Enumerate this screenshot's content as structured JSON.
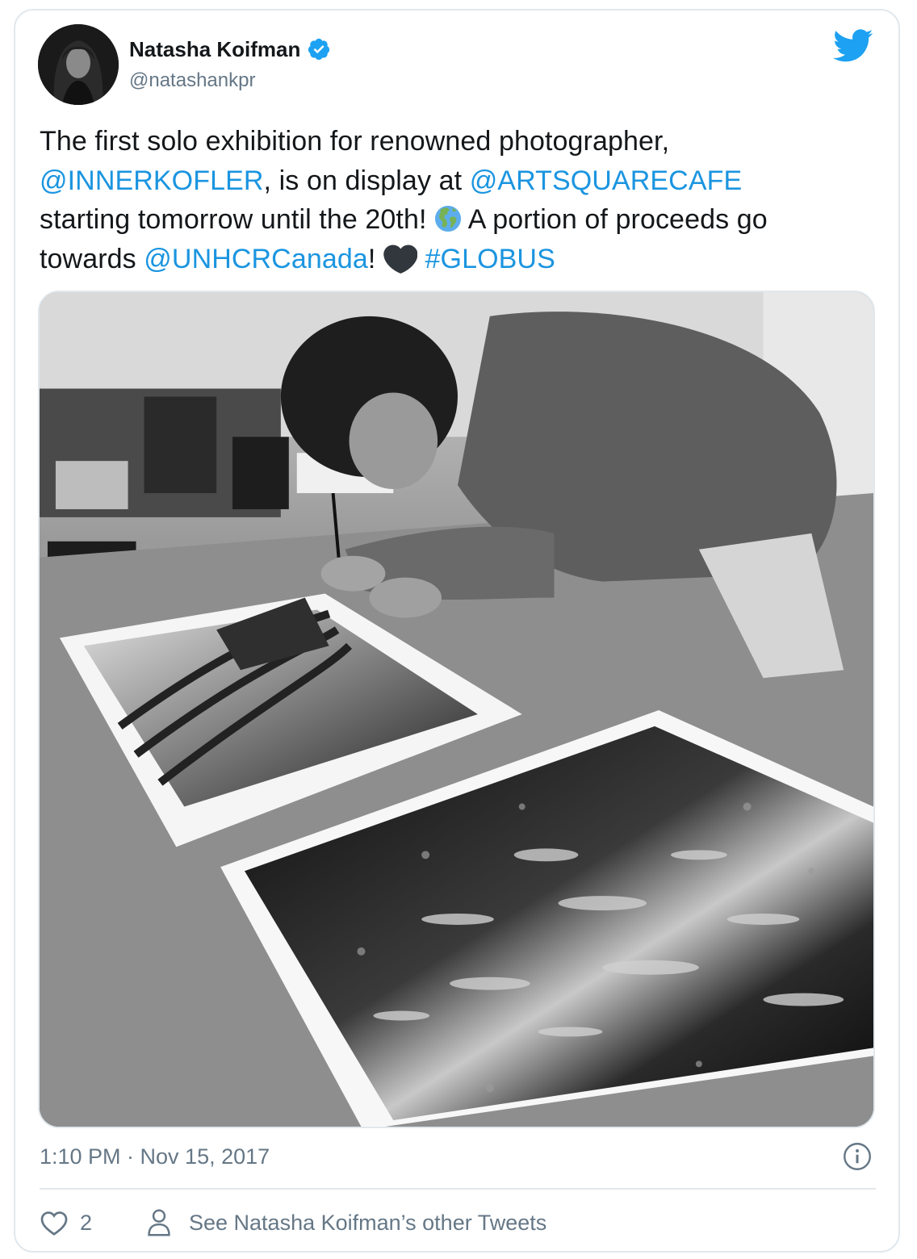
{
  "author": {
    "name": "Natasha Koifman",
    "handle": "@natashankpr",
    "verified": true
  },
  "tweet": {
    "line1": "The first solo exhibition for renowned photographer,",
    "mention1": "@INNERKOFLER",
    "text2": ", is on display at ",
    "mention2": "@ARTSQUARECAFE",
    "text3": "starting tomorrow until the 20th!",
    "text4": "  A portion of proceeds go towards ",
    "mention3": "@UNHCRCanada",
    "text5": "!",
    "hashtag": "#GLOBUS"
  },
  "meta": {
    "timestamp": "1:10 PM · Nov 15, 2017"
  },
  "actions": {
    "like_count": "2",
    "other_tweets_label": "See Natasha Koifman’s other Tweets"
  },
  "icons": {
    "brand": "twitter-bird-icon",
    "verified": "verified-badge-icon",
    "info": "info-icon",
    "like": "heart-icon",
    "profile": "person-icon",
    "globe_emoji": "globe-americas-emoji",
    "heart_emoji": "black-heart-emoji"
  },
  "colors": {
    "link": "#1b95e0",
    "text": "#14171a",
    "secondary": "#657786",
    "border": "#e1e8ed",
    "twitter_blue": "#1da1f2"
  }
}
